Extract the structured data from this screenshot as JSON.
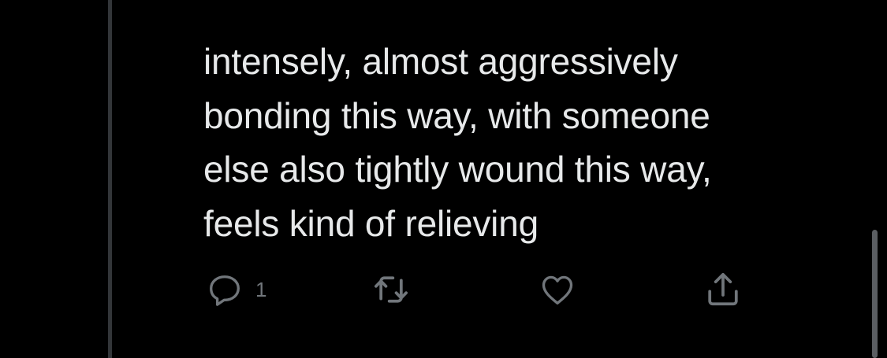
{
  "tweet": {
    "lines": [
      "intensely, almost aggressively",
      "bonding this way, with someone",
      "else also tightly wound this way,",
      "feels kind of relieving"
    ]
  },
  "actions": {
    "reply": {
      "icon": "reply-icon",
      "count": "1"
    },
    "retweet": {
      "icon": "retweet-icon"
    },
    "like": {
      "icon": "heart-icon"
    },
    "share": {
      "icon": "share-icon"
    }
  },
  "colors": {
    "background": "#000000",
    "text": "#e7e9ea",
    "icon": "#71767b",
    "thread_line": "#333639"
  }
}
